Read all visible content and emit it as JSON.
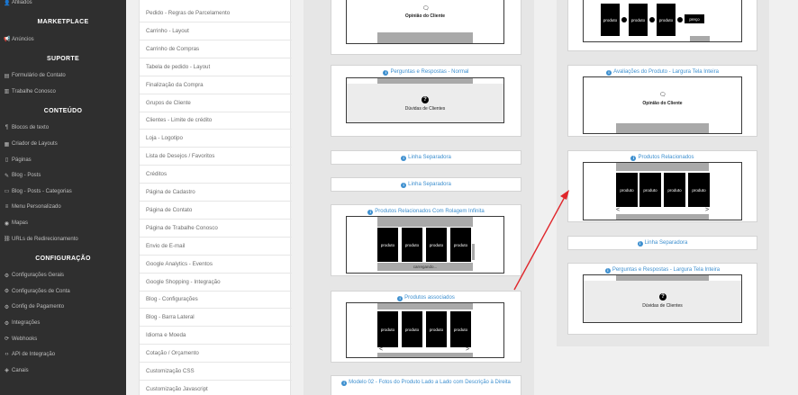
{
  "sidebar": {
    "sections": [
      {
        "type": "item",
        "label": "Afiliados",
        "icon": "user-icon"
      },
      {
        "type": "head",
        "label": "MARKETPLACE"
      },
      {
        "type": "item",
        "label": "Anúncios",
        "icon": "megaphone-icon"
      },
      {
        "type": "head",
        "label": "SUPORTE"
      },
      {
        "type": "item",
        "label": "Formulário de Contato",
        "icon": "form-icon"
      },
      {
        "type": "item",
        "label": "Trabalhe Conosco",
        "icon": "briefcase-icon"
      },
      {
        "type": "head",
        "label": "CONTEÚDO"
      },
      {
        "type": "item",
        "label": "Blocos de texto",
        "icon": "text-icon"
      },
      {
        "type": "item",
        "label": "Criador de Layouts",
        "icon": "layout-icon"
      },
      {
        "type": "item",
        "label": "Páginas",
        "icon": "page-icon"
      },
      {
        "type": "item",
        "label": "Blog - Posts",
        "icon": "pencil-icon"
      },
      {
        "type": "item",
        "label": "Blog - Posts - Categorias",
        "icon": "folder-icon"
      },
      {
        "type": "item",
        "label": "Menu Personalizado",
        "icon": "menu-icon"
      },
      {
        "type": "item",
        "label": "Mapas",
        "icon": "map-icon"
      },
      {
        "type": "item",
        "label": "URLs de Redirecionamento",
        "icon": "link-icon"
      },
      {
        "type": "head",
        "label": "CONFIGURAÇÃO"
      },
      {
        "type": "item",
        "label": "Configurações Gerais",
        "icon": "gear-icon"
      },
      {
        "type": "item",
        "label": "Configurações de Conta",
        "icon": "gear-icon"
      },
      {
        "type": "item",
        "label": "Config de Pagamento",
        "icon": "gear-icon"
      },
      {
        "type": "item",
        "label": "Integrações",
        "icon": "gear-icon"
      },
      {
        "type": "item",
        "label": "Webhooks",
        "icon": "webhook-icon"
      },
      {
        "type": "item",
        "label": "API de Integração",
        "icon": "code-icon"
      },
      {
        "type": "item",
        "label": "Canais",
        "icon": "channel-icon"
      }
    ]
  },
  "pagelist": {
    "items": [
      "Pedido - Regras de Parcelamento",
      "Carrinho - Layout",
      "Carrinho de Compras",
      "Tabela de pedido - Layout",
      "Finalização da Compra",
      "Grupos de Cliente",
      "Clientes - Limite de crédito",
      "Loja - Logotipo",
      "Lista de Desejos / Favoritos",
      "Créditos",
      "Página de Cadastro",
      "Página de Contato",
      "Página de Trabalhe Conosco",
      "Envio de E-mail",
      "Google Analytics - Eventos",
      "Google Shopping - Integração",
      "Blog - Configurações",
      "Blog - Barra Lateral",
      "Idioma e Moeda",
      "Cotação / Orçamento",
      "Customização CSS",
      "Customização Javascript"
    ]
  },
  "left_col": {
    "card1": {
      "caption": "Opinião do Cliente"
    },
    "card2": {
      "title": "Perguntas e Respostas - Normal",
      "caption": "Dúvidas de Clientes",
      "icon": "?"
    },
    "card3": {
      "title": "Linha Separadora"
    },
    "card4": {
      "title": "Linha Separadora"
    },
    "card5": {
      "title": "Produtos Relacionados Com Rolagem Infinita",
      "tile_label": "produto",
      "button": "carregando..."
    },
    "card6": {
      "title": "Produtos associados",
      "tile_label": "produto"
    },
    "card7": {
      "title": "Modelo 02 - Fotos do Produto Lado a Lado com Descrição à Direita"
    }
  },
  "right_col": {
    "card1": {
      "tile_label": "produto",
      "price_label": "preço"
    },
    "card2": {
      "title": "Avaliações do Produto - Largura Tela Inteira",
      "caption": "Opinião do Cliente"
    },
    "card3": {
      "title": "Produtos Relacionados",
      "tile_label": "produto"
    },
    "card4": {
      "title": "Linha Separadora"
    },
    "card5": {
      "title": "Perguntas e Respostas - Largura Tela Inteira",
      "caption": "Dúvidas de Clientes",
      "icon": "?"
    }
  },
  "colors": {
    "link": "#3d8fcf",
    "sidebar_bg": "#2f2f2f",
    "arrow": "#e0262b"
  }
}
